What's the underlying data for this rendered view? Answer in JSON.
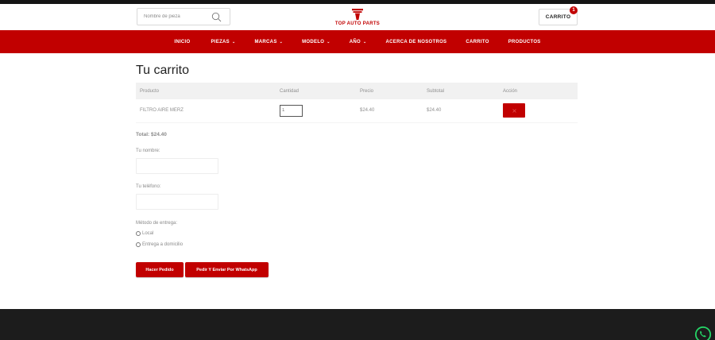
{
  "header": {
    "search_placeholder": "Nombre de pieza",
    "logo_text": "TOP AUTO PARTS",
    "cart_label": "CARRITO",
    "cart_count": "1"
  },
  "nav": {
    "items": [
      {
        "label": "INICIO",
        "has_dropdown": false
      },
      {
        "label": "PIEZAS",
        "has_dropdown": true
      },
      {
        "label": "MARCAS",
        "has_dropdown": true
      },
      {
        "label": "MODELO",
        "has_dropdown": true
      },
      {
        "label": "AÑO",
        "has_dropdown": true
      },
      {
        "label": "ACERCA DE NOSOTROS",
        "has_dropdown": false
      },
      {
        "label": "CARRITO",
        "has_dropdown": false
      },
      {
        "label": "PRODUCTOS",
        "has_dropdown": false
      }
    ]
  },
  "page": {
    "title": "Tu carrito"
  },
  "table": {
    "columns": [
      "Producto",
      "Cantidad",
      "Precio",
      "Subtotal",
      "Acción"
    ],
    "rows": [
      {
        "product": "FILTRO AIRE MERZ",
        "quantity": "1",
        "price": "$24.40",
        "subtotal": "$24.40"
      }
    ]
  },
  "form": {
    "total": "Total: $24.40",
    "name_label": "Tu nombre:",
    "name_value": "",
    "phone_label": "Tu teléfono:",
    "phone_value": "",
    "delivery_label": "Método de entrega:",
    "delivery_options": [
      "Local",
      "Entrega a domicilio"
    ],
    "submit_label": "Hacer Pedido",
    "whatsapp_label": "Pedir Y Enviar Por WhatsApp"
  },
  "colors": {
    "brand_red": "#c10000",
    "footer": "#1c1c1c",
    "whatsapp": "#25d366"
  },
  "icons": [
    "search-icon",
    "logo-icon",
    "chevron-down-icon",
    "close-icon",
    "whatsapp-icon"
  ]
}
